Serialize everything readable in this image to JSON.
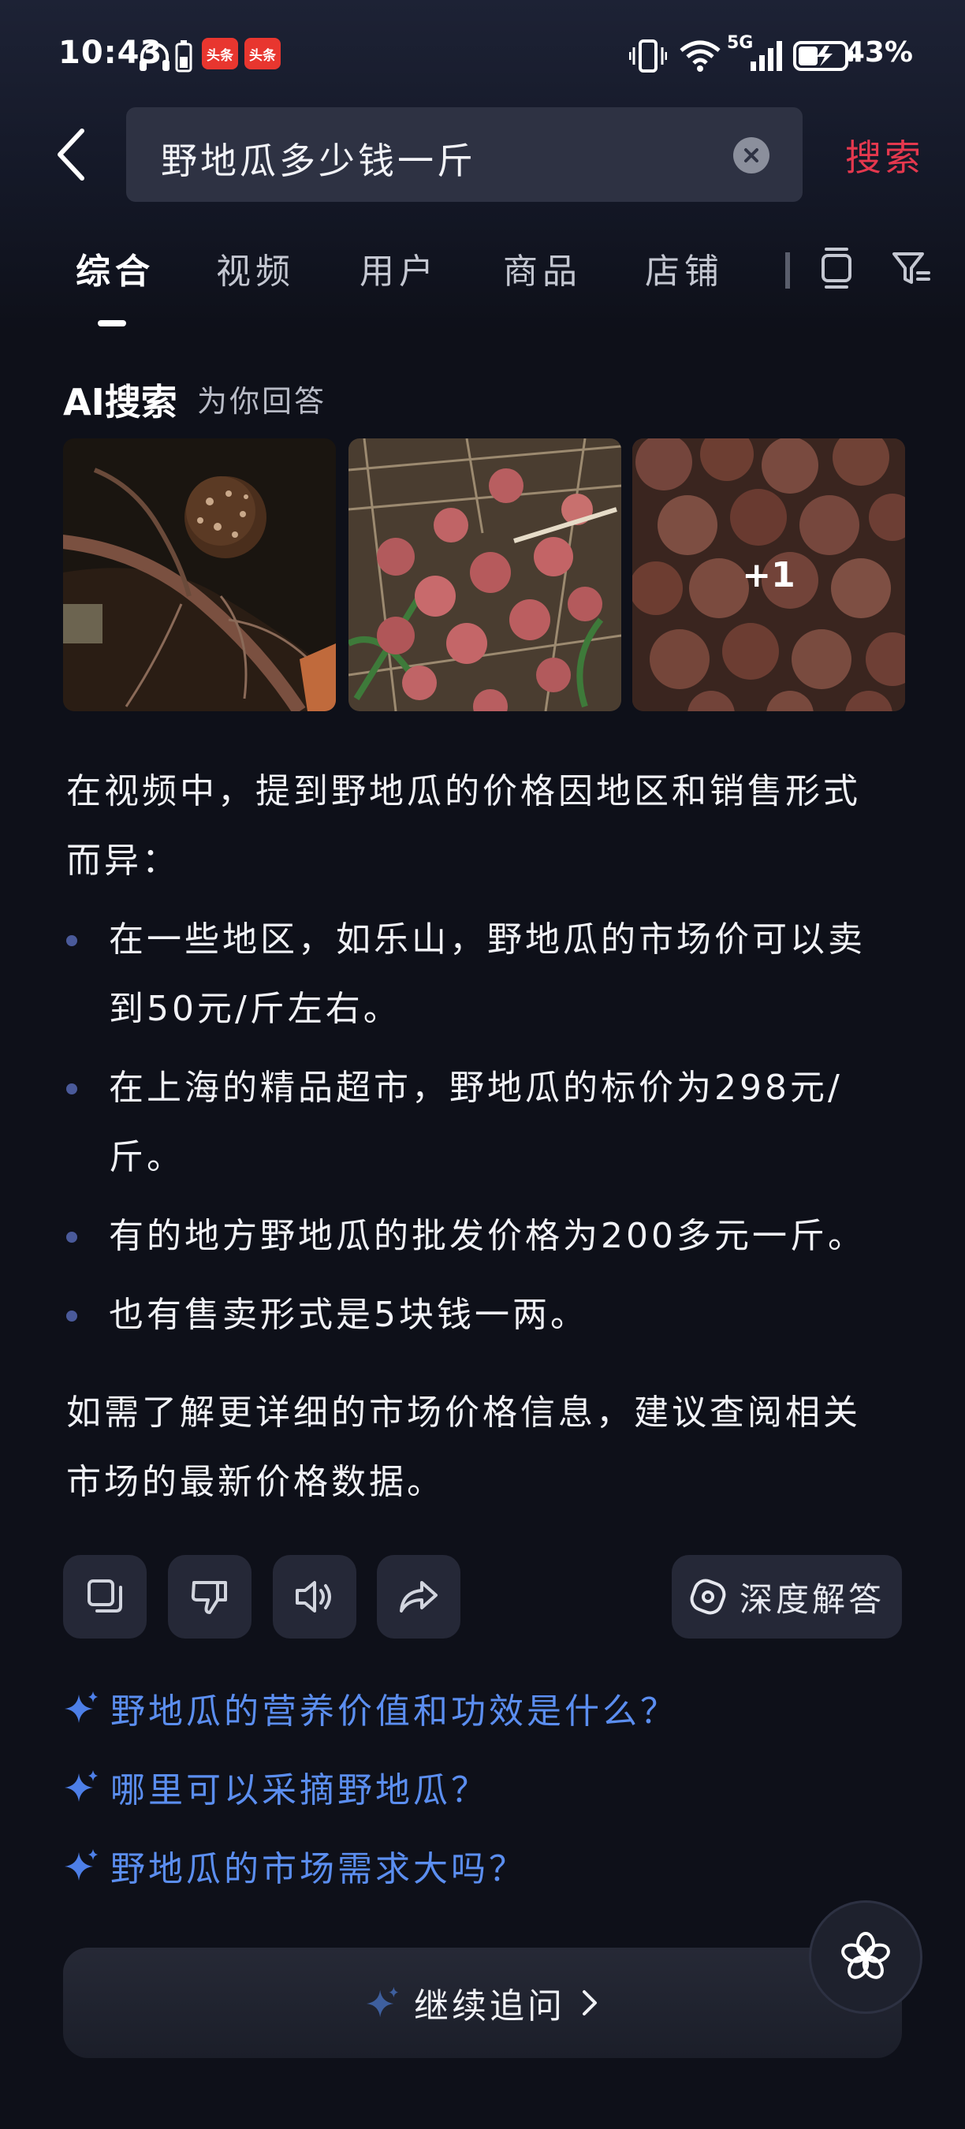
{
  "status_bar": {
    "time": "10:43",
    "badge_1": "头条",
    "badge_2": "头条",
    "network": "5G",
    "battery": "43%"
  },
  "search": {
    "query": "野地瓜多少钱一斤",
    "submit_label": "搜索"
  },
  "tabs": [
    {
      "label": "综合",
      "active": true
    },
    {
      "label": "视频",
      "active": false
    },
    {
      "label": "用户",
      "active": false
    },
    {
      "label": "商品",
      "active": false
    },
    {
      "label": "店铺",
      "active": false
    }
  ],
  "ai_section": {
    "title": "AI搜索",
    "subtitle": "为你回答",
    "more_images_label": "+1",
    "intro": "在视频中，提到野地瓜的价格因地区和销售形式而异：",
    "bullets": [
      "在一些地区，如乐山，野地瓜的市场价可以卖到50元/斤左右。",
      "在上海的精品超市，野地瓜的标价为298元/斤。",
      "有的地方野地瓜的批发价格为200多元一斤。",
      "也有售卖形式是5块钱一两。"
    ],
    "conclusion": "如需了解更详细的市场价格信息，建议查阅相关市场的最新价格数据。",
    "deep_answer_label": "深度解答"
  },
  "suggestions": [
    "野地瓜的营养价值和功效是什么？",
    "哪里可以采摘野地瓜？",
    "野地瓜的市场需求大吗？"
  ],
  "continue_label": "继续追问",
  "colors": {
    "background": "#0e1019",
    "accent_red": "#e5384e",
    "suggestion_blue": "#5b8ef0"
  }
}
